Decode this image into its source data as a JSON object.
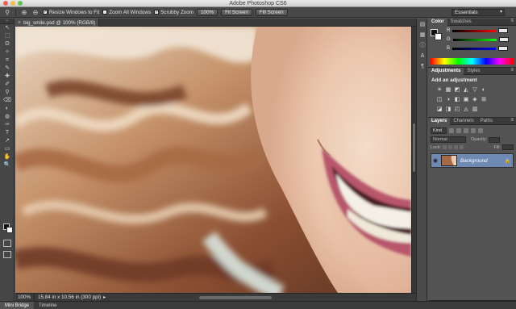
{
  "window": {
    "title": "Adobe Photoshop CS6",
    "traffic_lights": [
      "#ec5f5a",
      "#f4be4f",
      "#62c554"
    ]
  },
  "options_bar": {
    "tool_icon": "zoom-tool-icon",
    "zoom_in_icon": "zoom-in-icon",
    "zoom_out_icon": "zoom-out-icon",
    "resize_windows": {
      "label": "Resize Windows to Fit",
      "checked": true
    },
    "zoom_all": {
      "label": "Zoom All Windows",
      "checked": false
    },
    "scrubby_zoom": {
      "label": "Scrubby Zoom",
      "checked": true
    },
    "btn_100": "100%",
    "btn_fit": "Fit Screen",
    "btn_fill": "Fill Screen",
    "workspace": "Essentials"
  },
  "document": {
    "tab_title": "big_smile.psd @ 100% (RGB/8)",
    "zoom": "100%",
    "doc_info": "15.84 in x 10.56 in (300 ppi)"
  },
  "tools": [
    "↖",
    "⬚",
    "ʘ",
    "✧",
    "⌗",
    "✎",
    "✚",
    "✐",
    "⚲",
    "⌫",
    "◐",
    "◍",
    "✑",
    "T",
    "↗",
    "▭",
    "✋",
    "🔍"
  ],
  "bottom_tabs": [
    "Mini Bridge",
    "Timeline"
  ],
  "color_panel": {
    "tabs": [
      "Color",
      "Swatches"
    ],
    "channels": [
      {
        "label": "R",
        "gradient": "linear-gradient(to right,#000,#f00)"
      },
      {
        "label": "G",
        "gradient": "linear-gradient(to right,#000,#0f0)"
      },
      {
        "label": "B",
        "gradient": "linear-gradient(to right,#000,#00f)"
      }
    ]
  },
  "adjustments_panel": {
    "tabs": [
      "Adjustments",
      "Styles"
    ],
    "title": "Add an adjustment",
    "row1": [
      "☀",
      "▦",
      "◩",
      "◭",
      "▽",
      "◐"
    ],
    "row2": [
      "◫",
      "◑",
      "◧",
      "▣",
      "◈",
      "⊞"
    ],
    "row3": [
      "◪",
      "◨",
      "◰",
      "◬",
      "▥"
    ]
  },
  "layers_panel": {
    "tabs": [
      "Layers",
      "Channels",
      "Paths"
    ],
    "kind": "Kind",
    "blend": "Normal",
    "opacity_label": "Opacity:",
    "lock_label": "Lock:",
    "fill_label": "Fill:",
    "layer_name": "Background",
    "footer_icons": [
      "∞",
      "fx",
      "◐",
      "◉",
      "▭",
      "▤",
      "🗑"
    ]
  }
}
